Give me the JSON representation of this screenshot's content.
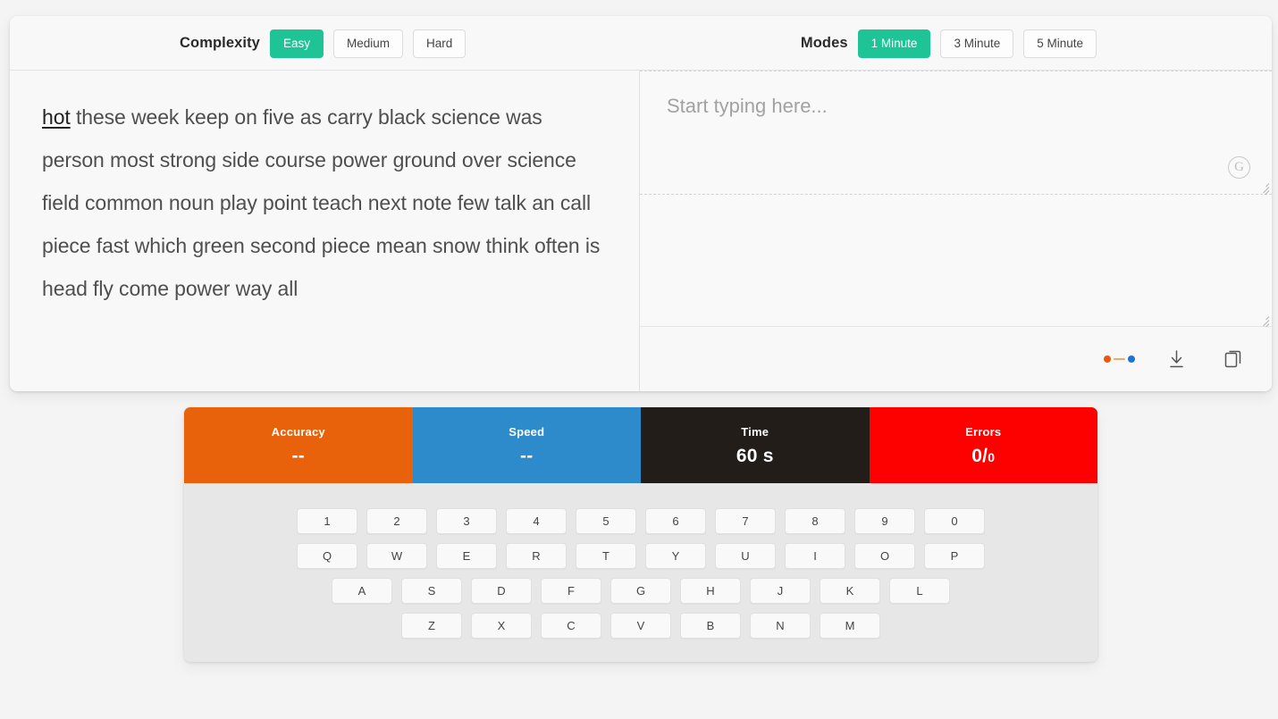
{
  "toolbar": {
    "complexity_label": "Complexity",
    "complexity_options": [
      {
        "label": "Easy",
        "active": true
      },
      {
        "label": "Medium",
        "active": false
      },
      {
        "label": "Hard",
        "active": false
      }
    ],
    "modes_label": "Modes",
    "mode_options": [
      {
        "label": "1 Minute",
        "active": true
      },
      {
        "label": "3 Minute",
        "active": false
      },
      {
        "label": "5 Minute",
        "active": false
      }
    ],
    "accent_color": "#1fc496"
  },
  "passage": {
    "current_word": "hot",
    "rest": " these week keep on five as carry black science was person most strong side course power ground over science field common noun play point teach next note few talk an call piece fast which green second piece mean snow think often is head fly come power way all"
  },
  "input": {
    "placeholder": "Start typing here...",
    "value": "",
    "secondary_value": "",
    "grammar_glyph": "G"
  },
  "stats": [
    {
      "label": "Accuracy",
      "value": "--",
      "denominator": "",
      "color": "#e8620c"
    },
    {
      "label": "Speed",
      "value": "--",
      "denominator": "",
      "color": "#2e8bcb"
    },
    {
      "label": "Time",
      "value": "60 s",
      "denominator": "",
      "color": "#231d1a"
    },
    {
      "label": "Errors",
      "value": "0/",
      "denominator": "0",
      "color": "#fd0000"
    }
  ],
  "keyboard": {
    "rows": [
      [
        "1",
        "2",
        "3",
        "4",
        "5",
        "6",
        "7",
        "8",
        "9",
        "0"
      ],
      [
        "Q",
        "W",
        "E",
        "R",
        "T",
        "Y",
        "U",
        "I",
        "O",
        "P"
      ],
      [
        "A",
        "S",
        "D",
        "F",
        "G",
        "H",
        "J",
        "K",
        "L"
      ],
      [
        "Z",
        "X",
        "C",
        "V",
        "B",
        "N",
        "M"
      ]
    ]
  }
}
